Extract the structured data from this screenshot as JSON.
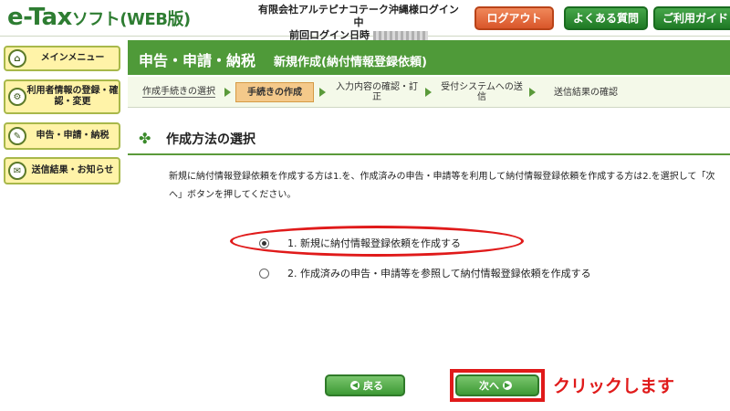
{
  "header": {
    "logo_main": "e-Tax",
    "logo_sub": "ソフト(WEB版)",
    "login_user": "有限会社アルテピナコテーク沖縄様ログイン中",
    "last_login_label": "前回ログイン日時",
    "logout_label": "ログアウト",
    "faq_label": "よくある質問",
    "guide_label": "ご利用ガイド"
  },
  "sidebar": {
    "items": [
      {
        "label": "メインメニュー",
        "icon": "home-icon"
      },
      {
        "label": "利用者情報の登録・確認・変更",
        "icon": "user-settings-icon"
      },
      {
        "label": "申告・申請・納税",
        "icon": "document-icon"
      },
      {
        "label": "送信結果・お知らせ",
        "icon": "mail-icon"
      }
    ]
  },
  "main": {
    "title": "申告・申請・納税",
    "subtitle": "新規作成(納付情報登録依頼)",
    "steps": [
      {
        "label": "作成手続きの選択",
        "active": false
      },
      {
        "label": "手続きの作成",
        "active": true
      },
      {
        "label": "入力内容の確認・訂正",
        "active": false
      },
      {
        "label": "受付システムへの送信",
        "active": false
      },
      {
        "label": "送信結果の確認",
        "active": false
      }
    ],
    "section_title": "作成方法の選択",
    "description": "新規に納付情報登録依頼を作成する方は1.を、作成済みの申告・申請等を利用して納付情報登録依頼を作成する方は2.を選択して「次へ」ボタンを押してください。",
    "options": [
      {
        "label": "1. 新規に納付情報登録依頼を作成する",
        "checked": true
      },
      {
        "label": "2. 作成済みの申告・申請等を参照して納付情報登録依頼を作成する",
        "checked": false
      }
    ],
    "back_label": "戻る",
    "next_label": "次へ",
    "annotation": "クリックします"
  },
  "colors": {
    "brand_green": "#4f9a39",
    "highlight_red": "#e01a1a",
    "logout_orange": "#d9562a"
  }
}
